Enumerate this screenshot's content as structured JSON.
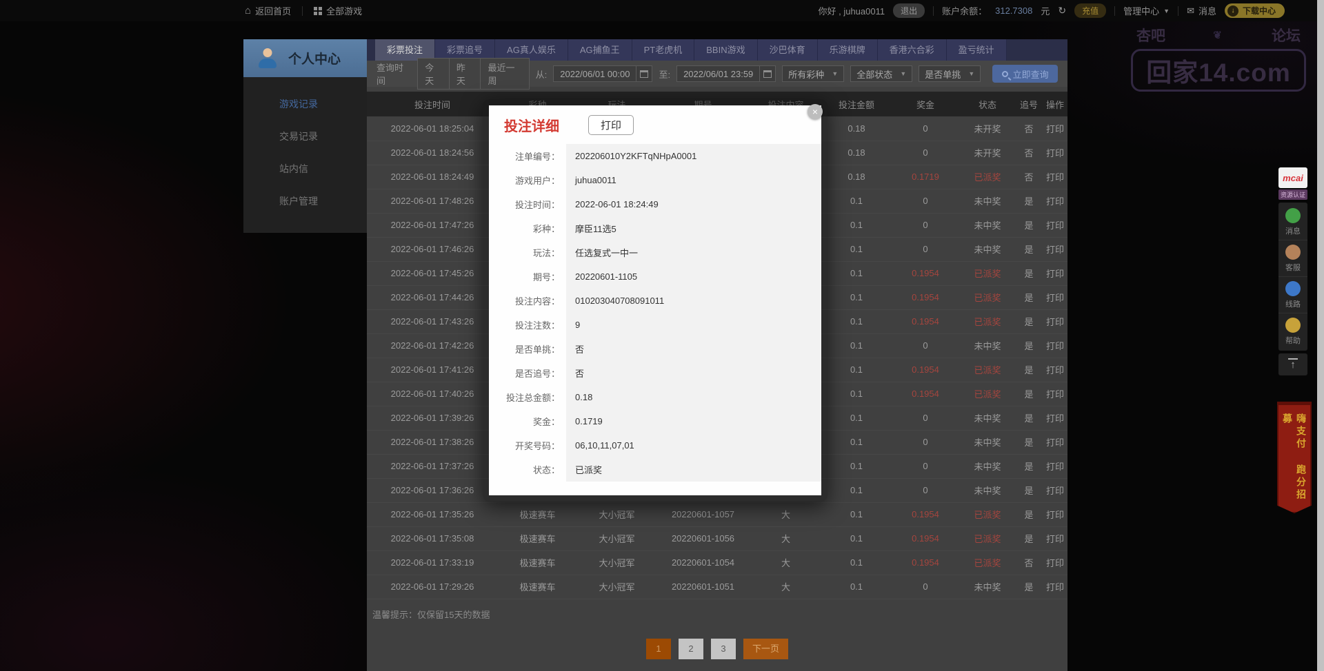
{
  "topbar": {
    "home": "返回首页",
    "all_games": "全部游戏",
    "greeting": "你好 , juhua0011",
    "logout": "退出",
    "balance_label": "账户余额：",
    "balance_value": "312.7308",
    "balance_unit": "元",
    "recharge": "充值",
    "admin_center": "管理中心",
    "messages": "消息",
    "download_center": "下载中心"
  },
  "watermark": {
    "left": "杏吧",
    "ornament": "❦",
    "right": "论坛",
    "domain": "回家14.com"
  },
  "sidebar": {
    "title": "个人中心",
    "items": [
      {
        "label": "游戏记录",
        "active": true
      },
      {
        "label": "交易记录",
        "active": false
      },
      {
        "label": "站内信",
        "active": false
      },
      {
        "label": "账户管理",
        "active": false
      }
    ]
  },
  "tabs": [
    {
      "label": "彩票投注",
      "active": true
    },
    {
      "label": "彩票追号",
      "active": false
    },
    {
      "label": "AG真人娱乐",
      "active": false
    },
    {
      "label": "AG捕鱼王",
      "active": false
    },
    {
      "label": "PT老虎机",
      "active": false
    },
    {
      "label": "BBIN游戏",
      "active": false
    },
    {
      "label": "沙巴体育",
      "active": false
    },
    {
      "label": "乐游棋牌",
      "active": false
    },
    {
      "label": "香港六合彩",
      "active": false
    },
    {
      "label": "盈亏统计",
      "active": false
    }
  ],
  "filters": {
    "label": "查询时间",
    "quick": [
      "今天",
      "昨天",
      "最近一周"
    ],
    "from_label": "从:",
    "from_value": "2022/06/01 00:00",
    "to_label": "至:",
    "to_value": "2022/06/01 23:59",
    "selects": [
      "所有彩种",
      "全部状态",
      "是否单挑"
    ],
    "query_button": "立即查询"
  },
  "table": {
    "headers": [
      "投注时间",
      "彩种",
      "玩法",
      "期号",
      "投注内容",
      "投注金额",
      "奖金",
      "状态",
      "追号",
      "操作"
    ],
    "rows": [
      {
        "time": "2022-06-01 18:25:04",
        "lottery": "",
        "play": "",
        "issue": "",
        "content": "",
        "amount": "0.18",
        "prize": "0",
        "status": "未开奖",
        "chase": "否",
        "action": "打印",
        "win": false
      },
      {
        "time": "2022-06-01 18:24:56",
        "lottery": "",
        "play": "",
        "issue": "",
        "content": "",
        "amount": "0.18",
        "prize": "0",
        "status": "未开奖",
        "chase": "否",
        "action": "打印",
        "win": false
      },
      {
        "time": "2022-06-01 18:24:49",
        "lottery": "",
        "play": "",
        "issue": "",
        "content": "",
        "amount": "0.18",
        "prize": "0.1719",
        "status": "已派奖",
        "chase": "否",
        "action": "打印",
        "win": true
      },
      {
        "time": "2022-06-01 17:48:26",
        "lottery": "",
        "play": "",
        "issue": "",
        "content": "",
        "amount": "0.1",
        "prize": "0",
        "status": "未中奖",
        "chase": "是",
        "action": "打印",
        "win": false
      },
      {
        "time": "2022-06-01 17:47:26",
        "lottery": "",
        "play": "",
        "issue": "",
        "content": "",
        "amount": "0.1",
        "prize": "0",
        "status": "未中奖",
        "chase": "是",
        "action": "打印",
        "win": false
      },
      {
        "time": "2022-06-01 17:46:26",
        "lottery": "",
        "play": "",
        "issue": "",
        "content": "",
        "amount": "0.1",
        "prize": "0",
        "status": "未中奖",
        "chase": "是",
        "action": "打印",
        "win": false
      },
      {
        "time": "2022-06-01 17:45:26",
        "lottery": "",
        "play": "",
        "issue": "",
        "content": "",
        "amount": "0.1",
        "prize": "0.1954",
        "status": "已派奖",
        "chase": "是",
        "action": "打印",
        "win": true
      },
      {
        "time": "2022-06-01 17:44:26",
        "lottery": "",
        "play": "",
        "issue": "",
        "content": "",
        "amount": "0.1",
        "prize": "0.1954",
        "status": "已派奖",
        "chase": "是",
        "action": "打印",
        "win": true
      },
      {
        "time": "2022-06-01 17:43:26",
        "lottery": "",
        "play": "",
        "issue": "",
        "content": "",
        "amount": "0.1",
        "prize": "0.1954",
        "status": "已派奖",
        "chase": "是",
        "action": "打印",
        "win": true
      },
      {
        "time": "2022-06-01 17:42:26",
        "lottery": "",
        "play": "",
        "issue": "",
        "content": "",
        "amount": "0.1",
        "prize": "0",
        "status": "未中奖",
        "chase": "是",
        "action": "打印",
        "win": false
      },
      {
        "time": "2022-06-01 17:41:26",
        "lottery": "",
        "play": "",
        "issue": "",
        "content": "",
        "amount": "0.1",
        "prize": "0.1954",
        "status": "已派奖",
        "chase": "是",
        "action": "打印",
        "win": true
      },
      {
        "time": "2022-06-01 17:40:26",
        "lottery": "",
        "play": "",
        "issue": "",
        "content": "",
        "amount": "0.1",
        "prize": "0.1954",
        "status": "已派奖",
        "chase": "是",
        "action": "打印",
        "win": true
      },
      {
        "time": "2022-06-01 17:39:26",
        "lottery": "",
        "play": "",
        "issue": "",
        "content": "",
        "amount": "0.1",
        "prize": "0",
        "status": "未中奖",
        "chase": "是",
        "action": "打印",
        "win": false
      },
      {
        "time": "2022-06-01 17:38:26",
        "lottery": "",
        "play": "",
        "issue": "",
        "content": "",
        "amount": "0.1",
        "prize": "0",
        "status": "未中奖",
        "chase": "是",
        "action": "打印",
        "win": false
      },
      {
        "time": "2022-06-01 17:37:26",
        "lottery": "",
        "play": "",
        "issue": "",
        "content": "",
        "amount": "0.1",
        "prize": "0",
        "status": "未中奖",
        "chase": "是",
        "action": "打印",
        "win": false
      },
      {
        "time": "2022-06-01 17:36:26",
        "lottery": "",
        "play": "",
        "issue": "",
        "content": "",
        "amount": "0.1",
        "prize": "0",
        "status": "未中奖",
        "chase": "是",
        "action": "打印",
        "win": false
      },
      {
        "time": "2022-06-01 17:35:26",
        "lottery": "极速赛车",
        "play": "大小冠军",
        "issue": "20220601-1057",
        "content": "大",
        "amount": "0.1",
        "prize": "0.1954",
        "status": "已派奖",
        "chase": "是",
        "action": "打印",
        "win": true
      },
      {
        "time": "2022-06-01 17:35:08",
        "lottery": "极速赛车",
        "play": "大小冠军",
        "issue": "20220601-1056",
        "content": "大",
        "amount": "0.1",
        "prize": "0.1954",
        "status": "已派奖",
        "chase": "是",
        "action": "打印",
        "win": true
      },
      {
        "time": "2022-06-01 17:33:19",
        "lottery": "极速赛车",
        "play": "大小冠军",
        "issue": "20220601-1054",
        "content": "大",
        "amount": "0.1",
        "prize": "0.1954",
        "status": "已派奖",
        "chase": "否",
        "action": "打印",
        "win": true
      },
      {
        "time": "2022-06-01 17:29:26",
        "lottery": "极速赛车",
        "play": "大小冠军",
        "issue": "20220601-1051",
        "content": "大",
        "amount": "0.1",
        "prize": "0",
        "status": "未中奖",
        "chase": "是",
        "action": "打印",
        "win": false
      }
    ]
  },
  "footer_note": "温馨提示：仅保留15天的数据",
  "pagination": {
    "pages": [
      "1",
      "2",
      "3"
    ],
    "active": "1",
    "next": "下一页"
  },
  "modal": {
    "title": "投注详细",
    "print_button": "打印",
    "close": "×",
    "fields": [
      {
        "label": "注单编号：",
        "value": "202206010Y2KFTqNHpA0001"
      },
      {
        "label": "游戏用户：",
        "value": "juhua0011"
      },
      {
        "label": "投注时间：",
        "value": "2022-06-01 18:24:49"
      },
      {
        "label": "彩种：",
        "value": "摩臣11选5"
      },
      {
        "label": "玩法：",
        "value": "任选复式一中一"
      },
      {
        "label": "期号：",
        "value": "20220601-1105"
      },
      {
        "label": "投注内容：",
        "value": "010203040708091011"
      },
      {
        "label": "投注注数：",
        "value": "9"
      },
      {
        "label": "是否单挑：",
        "value": "否"
      },
      {
        "label": "是否追号：",
        "value": "否"
      },
      {
        "label": "投注总金额：",
        "value": "0.18"
      },
      {
        "label": "奖金：",
        "value": "0.1719"
      },
      {
        "label": "开奖号码：",
        "value": "06,10,11,07,01"
      },
      {
        "label": "状态：",
        "value": "已派奖"
      }
    ]
  },
  "floating_panel": {
    "badge_logo": "mcai",
    "badge_tag": "资源认证",
    "items": [
      {
        "label": "消息",
        "color": "#43a047"
      },
      {
        "label": "客服",
        "color": "#b4825a"
      },
      {
        "label": "线路",
        "color": "#3d78c9"
      },
      {
        "label": "帮助",
        "color": "#c7a23a"
      }
    ],
    "back_to_top": "↑",
    "banner": "嗨支付 跑分招募"
  },
  "colors": {
    "accent_orange": "#9c4a03",
    "win_red": "#a5453e",
    "link_blue": "#44689e",
    "query_blue": "#4d689e",
    "gold": "#8a7628",
    "modal_title_red": "#d33a32"
  }
}
